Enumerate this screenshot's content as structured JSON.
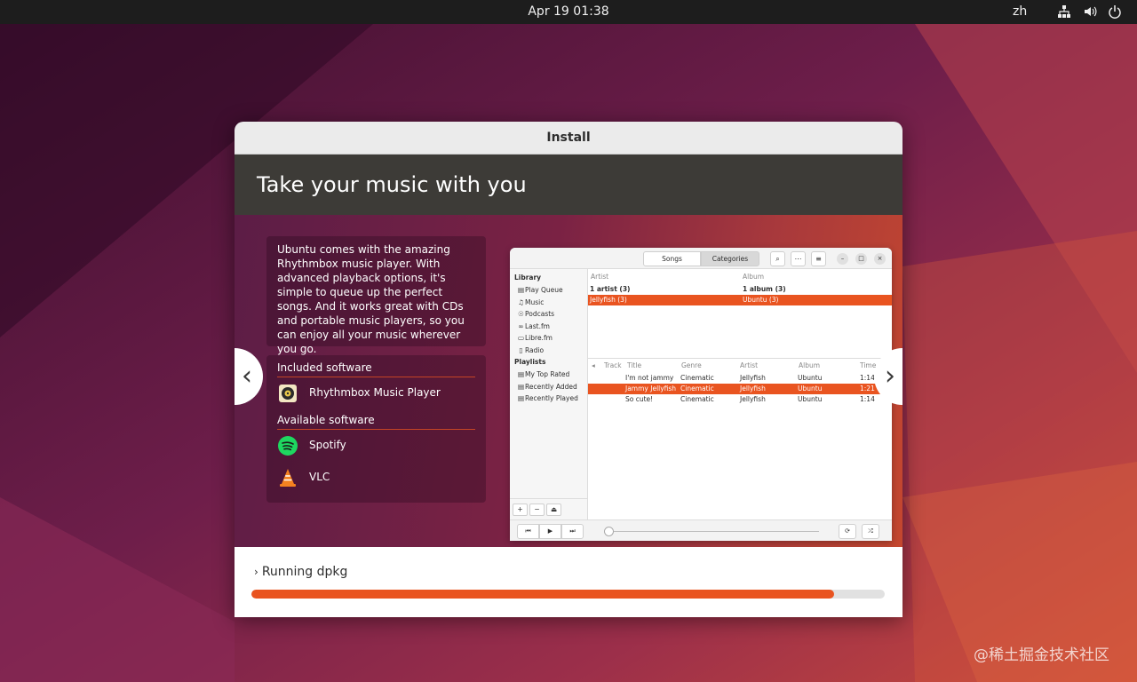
{
  "topbar": {
    "datetime": "Apr 19  01:38",
    "language": "zh",
    "icons": [
      "network-icon",
      "volume-icon",
      "power-icon"
    ]
  },
  "window": {
    "title": "Install",
    "slide_title": "Take your music with you",
    "description": "Ubuntu comes with the amazing Rhythmbox music player. With advanced playback options, it's simple to queue up the perfect songs. And it works great with CDs and portable music players, so you can enjoy all your music wherever you go.",
    "included_heading": "Included software",
    "included": [
      {
        "label": "Rhythmbox Music Player",
        "icon": "rhythmbox-icon"
      }
    ],
    "available_heading": "Available software",
    "available": [
      {
        "label": "Spotify",
        "icon": "spotify-icon"
      },
      {
        "label": "VLC",
        "icon": "vlc-icon"
      }
    ],
    "nav_prev": "‹",
    "nav_next": "›",
    "status_text": "Running dpkg",
    "progress": 0.92
  },
  "rhythmbox": {
    "tabs": [
      "Songs",
      "Categories"
    ],
    "sidebar_library_heading": "Library",
    "library_items": [
      "Play Queue",
      "Music",
      "Podcasts",
      "Last.fm",
      "Libre.fm",
      "Radio"
    ],
    "sidebar_playlists_heading": "Playlists",
    "playlist_items": [
      "My Top Rated",
      "Recently Added",
      "Recently Played"
    ],
    "browser_headers": [
      "Artist",
      "Album"
    ],
    "browser_rows": [
      {
        "artist": "1 artist (3)",
        "album": "1 album (3)",
        "bold": true
      },
      {
        "artist": "Jellyfish (3)",
        "album": "Ubuntu (3)",
        "selected": true
      }
    ],
    "track_headers": [
      "Track",
      "Title",
      "Genre",
      "Artist",
      "Album",
      "Time"
    ],
    "tracks": [
      {
        "title": "I'm not jammy",
        "genre": "Cinematic",
        "artist": "Jellyfish",
        "album": "Ubuntu",
        "time": "1:14"
      },
      {
        "title": "Jammy Jellyfish",
        "genre": "Cinematic",
        "artist": "Jellyfish",
        "album": "Ubuntu",
        "time": "1:21",
        "selected": true
      },
      {
        "title": "So cute!",
        "genre": "Cinematic",
        "artist": "Jellyfish",
        "album": "Ubuntu",
        "time": "1:14"
      }
    ]
  },
  "watermark": "@稀土掘金技术社区",
  "colors": {
    "accent": "#e95420",
    "header": "#3d3b37",
    "topbar": "#1d1d1d"
  }
}
